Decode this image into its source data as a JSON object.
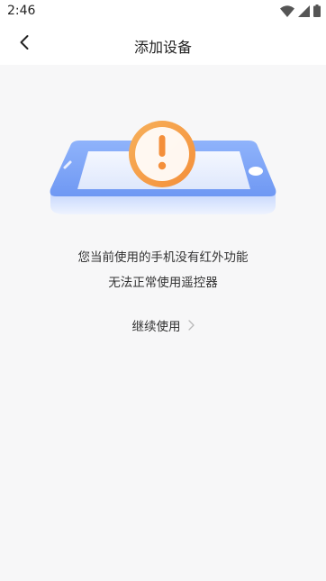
{
  "status_bar": {
    "time": "2:46",
    "icons": [
      "wifi-icon",
      "signal-icon",
      "battery-icon"
    ]
  },
  "header": {
    "title": "添加设备",
    "back_icon": "chevron-left-icon"
  },
  "illustration": {
    "icon": "phone-warning-icon",
    "warning_icon": "exclamation-icon",
    "colors": {
      "phone": "#7aa3f7",
      "screen": "#e9effd",
      "warning": "#f6a04d"
    }
  },
  "message": {
    "line1": "您当前使用的手机没有红外功能",
    "line2": "无法正常使用遥控器"
  },
  "continue": {
    "label": "继续使用",
    "icon": "chevron-right-icon"
  }
}
